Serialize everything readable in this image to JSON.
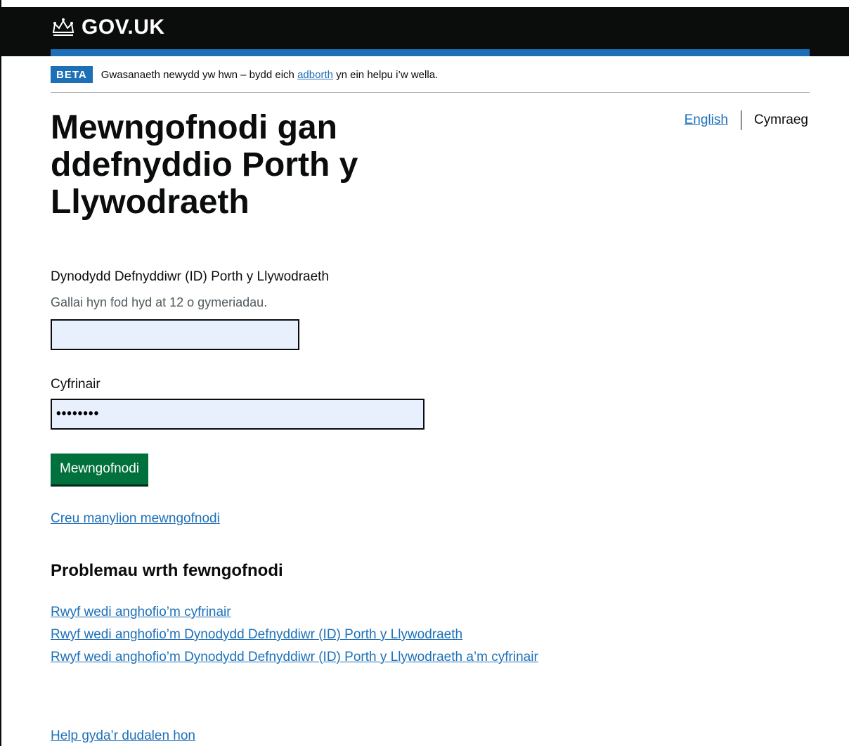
{
  "header": {
    "logo_text": "GOV.UK",
    "logo_icon": "crown-icon"
  },
  "phase_banner": {
    "tag": "BETA",
    "text_before": "Gwasanaeth newydd yw hwn – bydd eich ",
    "feedback_link": "adborth",
    "text_after": " yn ein helpu i’w wella."
  },
  "language": {
    "english": "English",
    "welsh": "Cymraeg"
  },
  "main": {
    "title": "Mewngofnodi gan ddefnyddio Porth y Llywodraeth",
    "user_id_label": "Dynodydd Defnyddiwr (ID) Porth y Llywodraeth",
    "user_id_hint": "Gallai hyn fod hyd at 12 o gymeriadau.",
    "user_id_value": "",
    "password_label": "Cyfrinair",
    "password_value": "••••••••",
    "signin_button": "Mewngofnodi",
    "create_link": "Creu manylion mewngofnodi"
  },
  "problems": {
    "heading": "Problemau wrth fewngofnodi",
    "links": [
      "Rwyf wedi anghofio’m cyfrinair",
      "Rwyf wedi anghofio’m Dynodydd Defnyddiwr (ID) Porth y Llywodraeth",
      "Rwyf wedi anghofio’m Dynodydd Defnyddiwr (ID) Porth y Llywodraeth a’m cyfrinair"
    ]
  },
  "footer": {
    "help_link": "Help gyda’r dudalen hon"
  },
  "colors": {
    "header_bg": "#0b0c0c",
    "brand_blue": "#1d70b8",
    "button_green": "#00703c",
    "input_fill": "#e8f0fe"
  }
}
